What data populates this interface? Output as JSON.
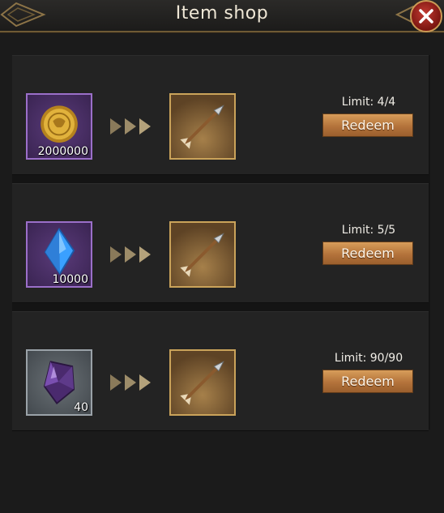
{
  "header": {
    "title": "Item shop"
  },
  "offers": [
    {
      "cost_icon": "gold-coin-icon",
      "cost_qty": "2000000",
      "reward_icon": "arrow-icon",
      "limit": "Limit: 4/4",
      "button": "Redeem"
    },
    {
      "cost_icon": "blue-crystal-icon",
      "cost_qty": "10000",
      "reward_icon": "arrow-icon",
      "limit": "Limit: 5/5",
      "button": "Redeem"
    },
    {
      "cost_icon": "purple-gem-icon",
      "cost_qty": "40",
      "reward_icon": "arrow-icon",
      "limit": "Limit: 90/90",
      "button": "Redeem"
    }
  ],
  "colors": {
    "header_border": "#6f5a34",
    "button": "#c9874a",
    "close": "#b02a24"
  }
}
